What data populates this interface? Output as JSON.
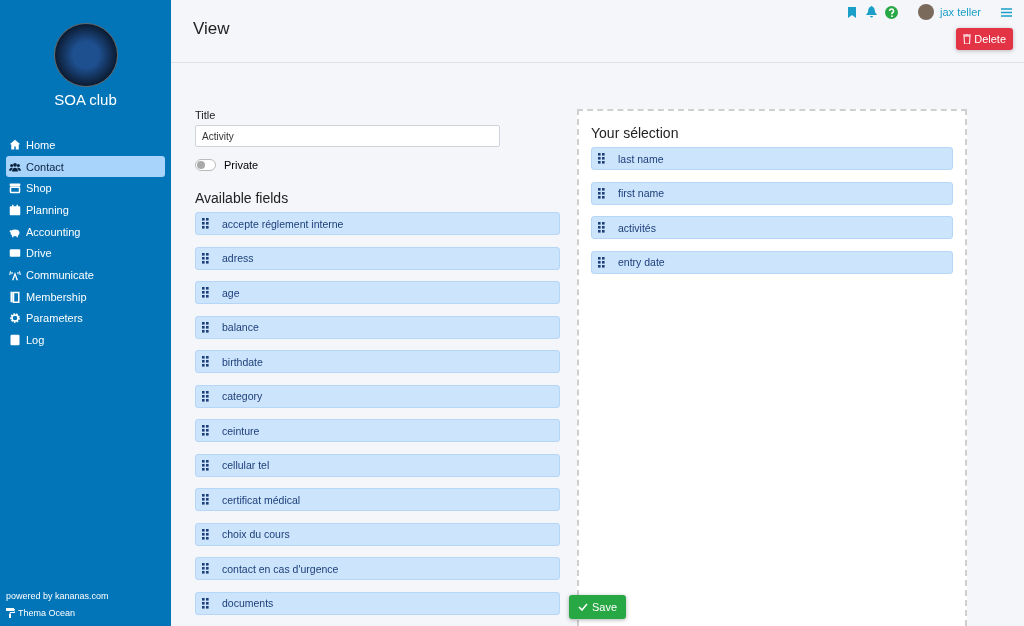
{
  "sidebar": {
    "club_name": "SOA club",
    "items": [
      {
        "label": "Home",
        "selected": false
      },
      {
        "label": "Contact",
        "selected": true
      },
      {
        "label": "Shop",
        "selected": false
      },
      {
        "label": "Planning",
        "selected": false
      },
      {
        "label": "Accounting",
        "selected": false
      },
      {
        "label": "Drive",
        "selected": false
      },
      {
        "label": "Communicate",
        "selected": false
      },
      {
        "label": "Membership",
        "selected": false
      },
      {
        "label": "Parameters",
        "selected": false
      },
      {
        "label": "Log",
        "selected": false
      }
    ],
    "footer": "powered by kananas.com",
    "theme": "Thema Ocean"
  },
  "header": {
    "title": "View",
    "user": "jax teller",
    "delete_button": "Delete"
  },
  "form": {
    "title_label": "Title",
    "title_value": "Activity",
    "private_label": "Private",
    "private_on": false
  },
  "available": {
    "heading": "Available fields",
    "items": [
      "accepte réglement interne",
      "adress",
      "age",
      "balance",
      "birthdate",
      "category",
      "ceinture",
      "cellular tel",
      "certificat médical",
      "choix du cours",
      "contact en cas d'urgence",
      "documents"
    ]
  },
  "selection": {
    "heading": "Your sélection",
    "items": [
      "last name",
      "first name",
      "activités",
      "entry date"
    ]
  },
  "save_button": "Save"
}
